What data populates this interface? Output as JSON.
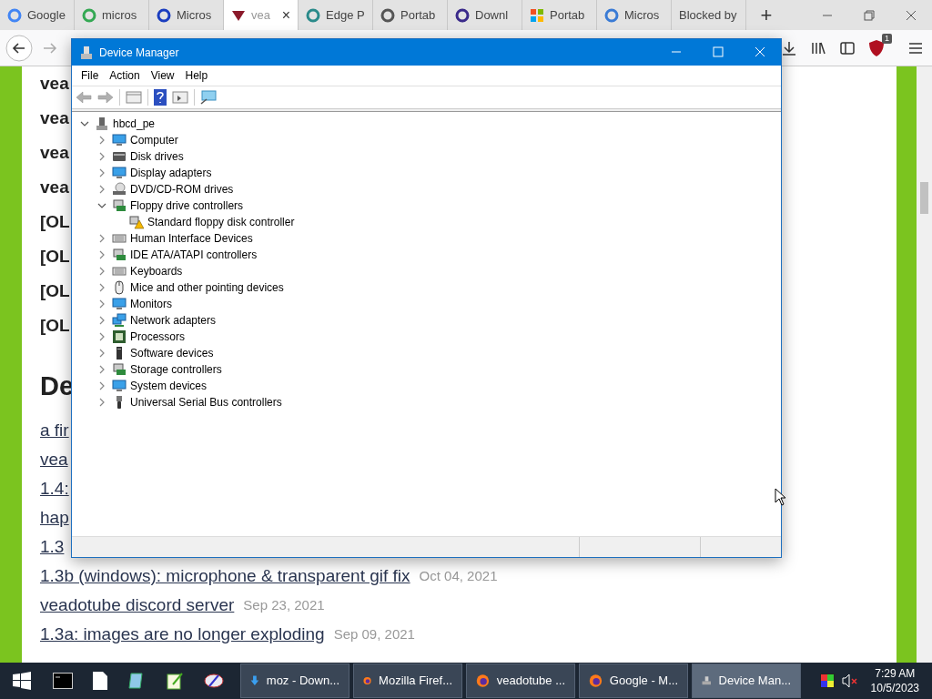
{
  "browser": {
    "tabs": [
      {
        "label": "Google",
        "selected": false
      },
      {
        "label": "micros",
        "selected": false
      },
      {
        "label": "Micros",
        "selected": false
      },
      {
        "label": "vea",
        "selected": true,
        "close": "×"
      },
      {
        "label": "Edge P",
        "selected": false
      },
      {
        "label": "Portab",
        "selected": false
      },
      {
        "label": "Downl",
        "selected": false
      },
      {
        "label": "Portab",
        "selected": false
      },
      {
        "label": "Micros",
        "selected": false
      },
      {
        "label": "Blocked by",
        "selected": false
      }
    ],
    "new_tab": "+",
    "addon_badge": "1"
  },
  "page": {
    "items": [
      {
        "kind": "bold",
        "text": "vea"
      },
      {
        "kind": "bold",
        "text": "vea"
      },
      {
        "kind": "bold",
        "text": "vea"
      },
      {
        "kind": "bold",
        "text": "vea"
      },
      {
        "kind": "bold",
        "text": "[OL"
      },
      {
        "kind": "bold",
        "text": "[OL"
      },
      {
        "kind": "bold",
        "text": "[OL"
      },
      {
        "kind": "bold",
        "text": "[OL"
      },
      {
        "kind": "heading",
        "text": "De"
      },
      {
        "kind": "link",
        "text": "a fir"
      },
      {
        "kind": "link",
        "text": "vea"
      },
      {
        "kind": "link",
        "text": "1.4:"
      },
      {
        "kind": "link",
        "text": "hap"
      },
      {
        "kind": "link",
        "text": "1.3"
      },
      {
        "kind": "link",
        "text": "1.3b (windows): microphone & transparent gif fix",
        "date": "Oct 04, 2021"
      },
      {
        "kind": "link",
        "text": "veadotube discord server",
        "date": "Sep 23, 2021"
      },
      {
        "kind": "link",
        "text": "1.3a: images are no longer exploding",
        "date": "Sep 09, 2021"
      }
    ]
  },
  "window": {
    "title": "Device Manager",
    "menu": [
      "File",
      "Action",
      "View",
      "Help"
    ],
    "tree": {
      "label": "hbcd_pe",
      "expanded": true,
      "children": [
        {
          "label": "Computer",
          "expanded": false
        },
        {
          "label": "Disk drives",
          "expanded": false
        },
        {
          "label": "Display adapters",
          "expanded": false
        },
        {
          "label": "DVD/CD-ROM drives",
          "expanded": false
        },
        {
          "label": "Floppy drive controllers",
          "expanded": true,
          "children": [
            {
              "label": "Standard floppy disk controller",
              "warning": true
            }
          ]
        },
        {
          "label": "Human Interface Devices",
          "expanded": false
        },
        {
          "label": "IDE ATA/ATAPI controllers",
          "expanded": false
        },
        {
          "label": "Keyboards",
          "expanded": false
        },
        {
          "label": "Mice and other pointing devices",
          "expanded": false
        },
        {
          "label": "Monitors",
          "expanded": false
        },
        {
          "label": "Network adapters",
          "expanded": false
        },
        {
          "label": "Processors",
          "expanded": false
        },
        {
          "label": "Software devices",
          "expanded": false
        },
        {
          "label": "Storage controllers",
          "expanded": false
        },
        {
          "label": "System devices",
          "expanded": false
        },
        {
          "label": "Universal Serial Bus controllers",
          "expanded": false
        }
      ]
    }
  },
  "taskbar": {
    "tasks": [
      {
        "label": "moz - Down...",
        "selected": false
      },
      {
        "label": "Mozilla Firef...",
        "selected": false
      },
      {
        "label": "veadotube ...",
        "selected": false
      },
      {
        "label": "Google - M...",
        "selected": false
      },
      {
        "label": "Device Man...",
        "selected": true
      }
    ],
    "time": "7:29 AM",
    "date": "10/5/2023"
  }
}
